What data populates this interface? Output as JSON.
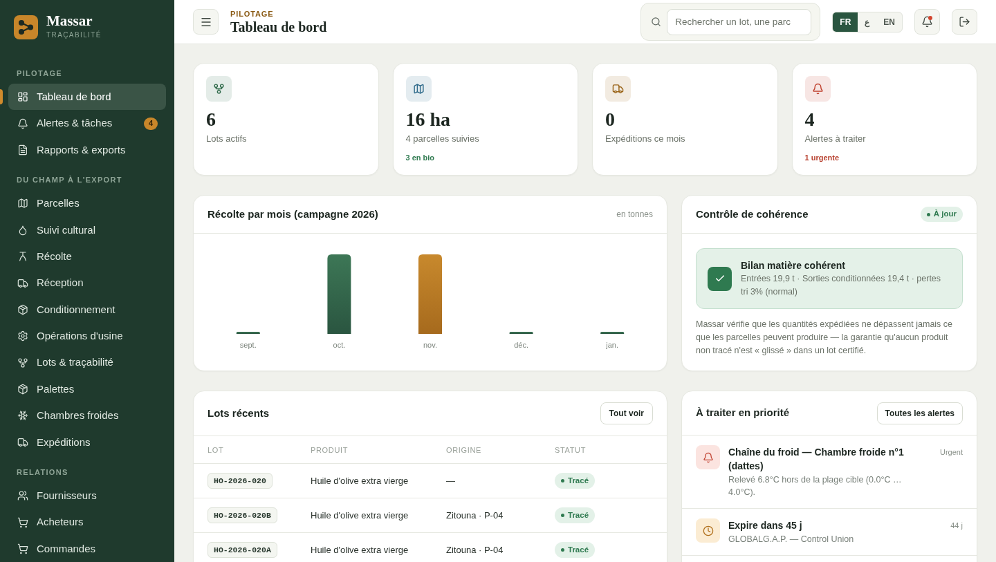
{
  "sidebar": {
    "brand": {
      "name": "Massar",
      "tagline": "TRAÇABILITÉ"
    },
    "sections": [
      {
        "label": "PILOTAGE",
        "items": [
          {
            "label": "Tableau de bord",
            "selected": true
          },
          {
            "label": "Alertes & tâches",
            "selected": false,
            "badge": "4"
          },
          {
            "label": "Rapports & exports",
            "selected": false
          }
        ]
      },
      {
        "label": "DU CHAMP À L'EXPORT",
        "items": [
          {
            "label": "Parcelles",
            "selected": false
          },
          {
            "label": "Suivi cultural",
            "selected": false
          },
          {
            "label": "Récolte",
            "selected": false
          },
          {
            "label": "Réception",
            "selected": false
          },
          {
            "label": "Conditionnement",
            "selected": false
          },
          {
            "label": "Opérations d'usine",
            "selected": false
          },
          {
            "label": "Lots & traçabilité",
            "selected": false
          },
          {
            "label": "Palettes",
            "selected": false
          },
          {
            "label": "Chambres froides",
            "selected": false
          },
          {
            "label": "Expéditions",
            "selected": false
          }
        ]
      },
      {
        "label": "RELATIONS",
        "items": [
          {
            "label": "Fournisseurs",
            "selected": false
          },
          {
            "label": "Acheteurs",
            "selected": false
          },
          {
            "label": "Commandes",
            "selected": false
          }
        ]
      }
    ]
  },
  "header": {
    "section": "PILOTAGE",
    "title": "Tableau de bord",
    "search": {
      "placeholder": "Rechercher un lot, une parc"
    },
    "languages": [
      {
        "label": "FR",
        "selected": true
      },
      {
        "label": "ع",
        "selected": false
      },
      {
        "label": "EN",
        "selected": false
      }
    ],
    "notifications": {
      "unread": true
    }
  },
  "stats": [
    {
      "value": "6",
      "label": "Lots actifs",
      "color": "#2f6a4a"
    },
    {
      "value": "16 ha",
      "label": "4 parcelles suivies",
      "color": "#2f6a8a",
      "note": {
        "text": "3 en bio",
        "color": "#2f7a50"
      }
    },
    {
      "value": "0",
      "label": "Expéditions ce mois",
      "color": "#9a6418"
    },
    {
      "value": "4",
      "label": "Alertes à traiter",
      "color": "#c0412f",
      "note": {
        "text": "1 urgente",
        "color": "#b8412f"
      }
    }
  ],
  "harvest": {
    "title": "Récolte par mois (campagne 2026)",
    "unit": "en tonnes",
    "months": [
      "sept.",
      "oct.",
      "nov.",
      "déc.",
      "jan."
    ]
  },
  "coherence": {
    "title": "Contrôle de cohérence",
    "status": "À jour",
    "result": {
      "title": "Bilan matière cohérent",
      "detail": "Entrées 19,9 t · Sorties conditionnées 19,4 t · pertes tri 3% (normal)"
    },
    "note": "Massar vérifie que les quantités expédiées ne dépassent jamais ce que les parcelles peuvent produire — la garantie qu'aucun produit non tracé n'est « glissé » dans un lot certifié."
  },
  "recent_lots": {
    "title": "Lots récents",
    "action": "Tout voir",
    "columns": [
      "LOT",
      "PRODUIT",
      "ORIGINE",
      "STATUT"
    ],
    "rows": [
      {
        "lot": "HO-2026-020",
        "product": "Huile d'olive extra vierge",
        "origin": "—",
        "status": "Tracé"
      },
      {
        "lot": "HO-2026-020B",
        "product": "Huile d'olive extra vierge",
        "origin": "Zitouna · P-04",
        "status": "Tracé"
      },
      {
        "lot": "HO-2026-020A",
        "product": "Huile d'olive extra vierge",
        "origin": "Zitouna · P-04",
        "status": "Tracé"
      }
    ]
  },
  "priorities": {
    "title": "À traiter en priorité",
    "action": "Toutes les alertes",
    "items": [
      {
        "kind": "alert",
        "title": "Chaîne du froid — Chambre froide n°1 (dattes)",
        "detail": "Relevé 6.8°C hors de la plage cible (0.0°C … 4.0°C).",
        "tag": "Urgent"
      },
      {
        "kind": "expiry",
        "title": "Expire dans 45 j",
        "detail": "GLOBALG.A.P. — Control Union",
        "tag": "44 j"
      }
    ]
  }
}
